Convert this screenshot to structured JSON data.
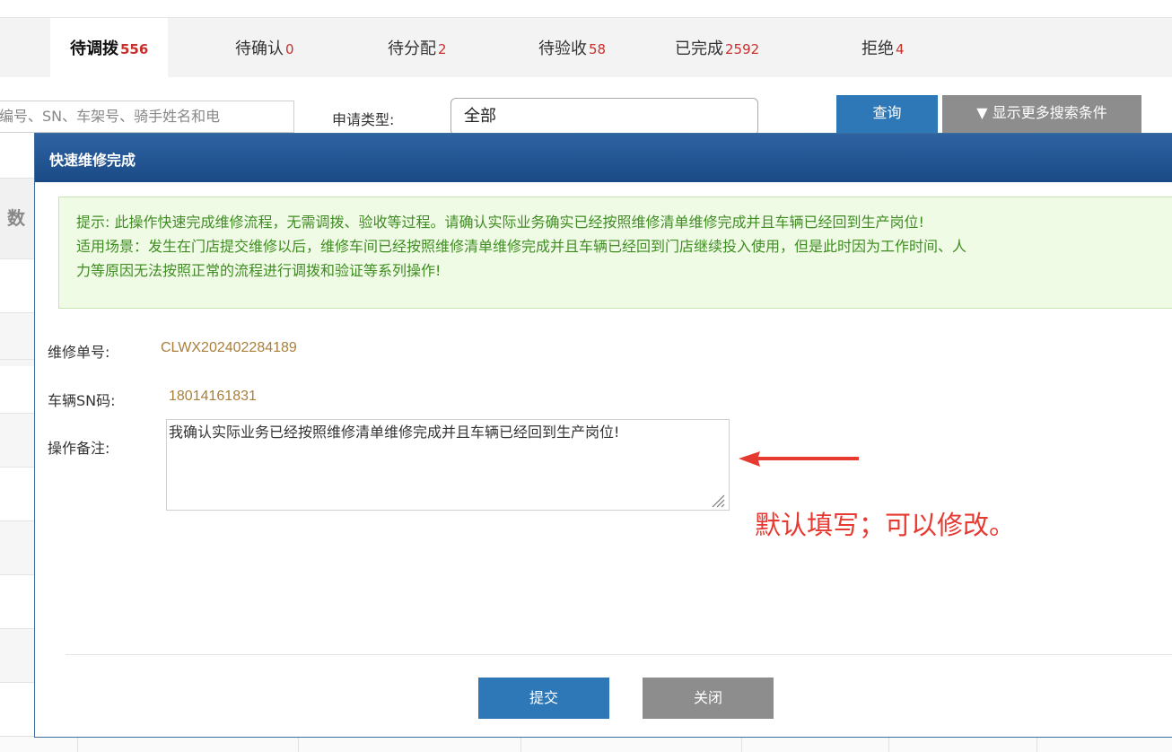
{
  "tabs": [
    {
      "label": "待调拨",
      "count": "556"
    },
    {
      "label": "待确认",
      "count": "0"
    },
    {
      "label": "待分配",
      "count": "2"
    },
    {
      "label": "待验收",
      "count": "58"
    },
    {
      "label": "已完成",
      "count": "2592"
    },
    {
      "label": "拒绝",
      "count": "4"
    }
  ],
  "search": {
    "keyword_placeholder": "编号、SN、车架号、骑手姓名和电",
    "type_label": "申请类型:",
    "type_value": "全部",
    "query_button": "查询",
    "more_button": "▼ 显示更多搜索条件"
  },
  "data_section_label": "数",
  "modal": {
    "title": "快速维修完成",
    "tip_line1": "提示: 此操作快速完成维修流程，无需调拨、验收等过程。请确认实际业务确实已经按照维修清单维修完成并且车辆已经回到生产岗位!",
    "tip_line2": "适用场景：发生在门店提交维修以后，维修车间已经按照维修清单维修完成并且车辆已经回到门店继续投入使用，但是此时因为工作时间、人",
    "tip_line3": "力等原因无法按照正常的流程进行调拨和验证等系列操作!",
    "order_label": "维修单号:",
    "order_value": "CLWX202402284189",
    "sn_label": "车辆SN码:",
    "sn_value": "18014161831",
    "remark_label": "操作备注:",
    "remark_value": "我确认实际业务已经按照维修清单维修完成并且车辆已经回到生产岗位!",
    "annotation": "默认填写；可以修改。",
    "submit_button": "提交",
    "close_button": "关闭"
  },
  "colors": {
    "primary": "#2f78b7",
    "secondary": "#8d8d8d",
    "count": "#c9302c",
    "tip_text": "#3f8d22",
    "value_text": "#a97f3a",
    "annotation": "#e63a31"
  }
}
